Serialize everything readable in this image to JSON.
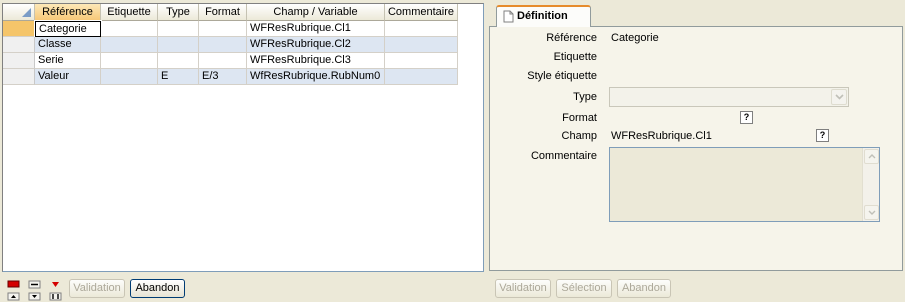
{
  "grid": {
    "headers": [
      "Référence",
      "Etiquette",
      "Type",
      "Format",
      "Champ / Variable",
      "Commentaire"
    ],
    "rows": [
      {
        "reference": "Categorie",
        "etiquette": "",
        "type": "",
        "format": "",
        "champ": "WFResRubrique.Cl1",
        "commentaire": ""
      },
      {
        "reference": "Classe",
        "etiquette": "",
        "type": "",
        "format": "",
        "champ": "WFResRubrique.Cl2",
        "commentaire": ""
      },
      {
        "reference": "Serie",
        "etiquette": "",
        "type": "",
        "format": "",
        "champ": "WFResRubrique.Cl3",
        "commentaire": ""
      },
      {
        "reference": "Valeur",
        "etiquette": "",
        "type": "E",
        "format": "E/3",
        "champ": "WfResRubrique.RubNum0",
        "commentaire": ""
      }
    ]
  },
  "left_buttons": {
    "validation": "Validation",
    "abandon": "Abandon"
  },
  "definition": {
    "tab_label": "Définition",
    "labels": {
      "reference": "Référence",
      "etiquette": "Etiquette",
      "style_etiquette": "Style étiquette",
      "type": "Type",
      "format": "Format",
      "champ": "Champ",
      "commentaire": "Commentaire"
    },
    "values": {
      "reference": "Categorie",
      "champ": "WFResRubrique.Cl1",
      "type": "",
      "commentaire": ""
    },
    "help_glyph": "?"
  },
  "right_buttons": {
    "validation": "Validation",
    "selection": "Sélection",
    "abandon": "Abandon"
  },
  "colors": {
    "selected_row_marker": "#f5c56a",
    "alt_row": "#dde6f2",
    "tab_accent": "#e68b2c",
    "nav_red": "#d40000"
  }
}
